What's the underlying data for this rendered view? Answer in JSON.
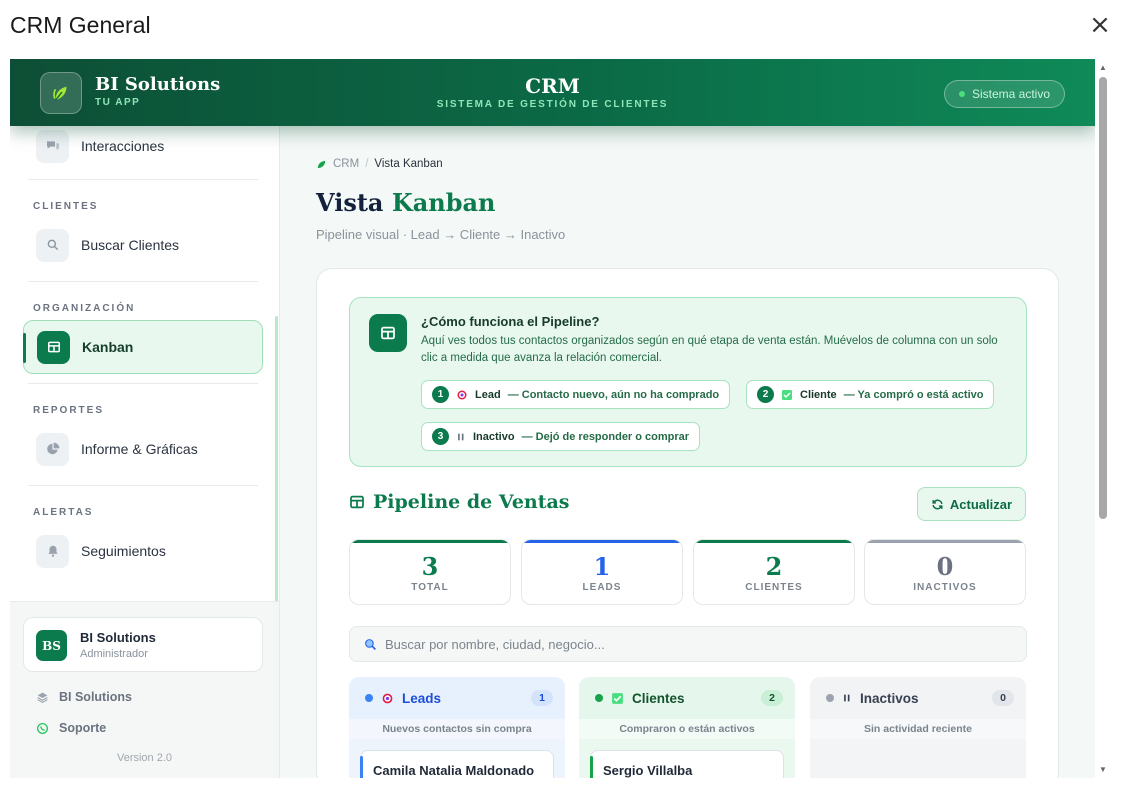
{
  "modal": {
    "title": "CRM General",
    "close": "×"
  },
  "header": {
    "brand_name": "BI Solutions",
    "brand_sub": "TU APP",
    "title": "CRM",
    "subtitle": "SISTEMA DE GESTIÓN DE CLIENTES",
    "status": "Sistema activo"
  },
  "sidebar": {
    "top_item": "Interacciones",
    "sections": [
      {
        "label": "CLIENTES",
        "item": "Buscar Clientes"
      },
      {
        "label": "ORGANIZACIÓN",
        "item": "Kanban"
      },
      {
        "label": "REPORTES",
        "item": "Informe & Gráficas"
      },
      {
        "label": "ALERTAS",
        "item": "Seguimientos"
      }
    ],
    "user": {
      "initials": "BS",
      "name": "BI Solutions",
      "role": "Administrador"
    },
    "footer_links": [
      "BI Solutions",
      "Soporte"
    ],
    "version": "Version 2.0"
  },
  "main": {
    "breadcrumb": {
      "root": "CRM",
      "sep": "/",
      "current": "Vista Kanban"
    },
    "title_plain": "Vista",
    "title_accent": "Kanban",
    "subtitle": "Pipeline visual · Lead → Cliente → Inactivo",
    "info": {
      "title": "¿Cómo funciona el Pipeline?",
      "text": "Aquí ves todos tus contactos organizados según en qué etapa de venta están. Muévelos de columna con un solo clic a medida que avanza la relación comercial.",
      "steps": [
        {
          "num": "1",
          "name": "Lead",
          "desc": "— Contacto nuevo, aún no ha comprado"
        },
        {
          "num": "2",
          "name": "Cliente",
          "desc": "— Ya compró o está activo"
        },
        {
          "num": "3",
          "name": "Inactivo",
          "desc": "— Dejó de responder o comprar"
        }
      ]
    },
    "pipeline_title": "Pipeline de Ventas",
    "refresh_label": "Actualizar",
    "stats": [
      {
        "value": "3",
        "label": "TOTAL",
        "color": "#0b7a4d"
      },
      {
        "value": "1",
        "label": "LEADS",
        "color": "#2563eb"
      },
      {
        "value": "2",
        "label": "CLIENTES",
        "color": "#0b7a4d"
      },
      {
        "value": "0",
        "label": "INACTIVOS",
        "color": "#6b7280"
      }
    ],
    "search_placeholder": "Buscar por nombre, ciudad, negocio...",
    "columns": [
      {
        "name": "Leads",
        "count": "1",
        "sub": "Nuevos contactos sin compra",
        "color": "#3b82f6",
        "cards": [
          "Camila Natalia Maldonado"
        ]
      },
      {
        "name": "Clientes",
        "count": "2",
        "sub": "Compraron o están activos",
        "color": "#16a34a",
        "cards": [
          "Sergio Villalba"
        ]
      },
      {
        "name": "Inactivos",
        "count": "0",
        "sub": "Sin actividad reciente",
        "color": "#9ca3af",
        "cards": []
      }
    ]
  }
}
